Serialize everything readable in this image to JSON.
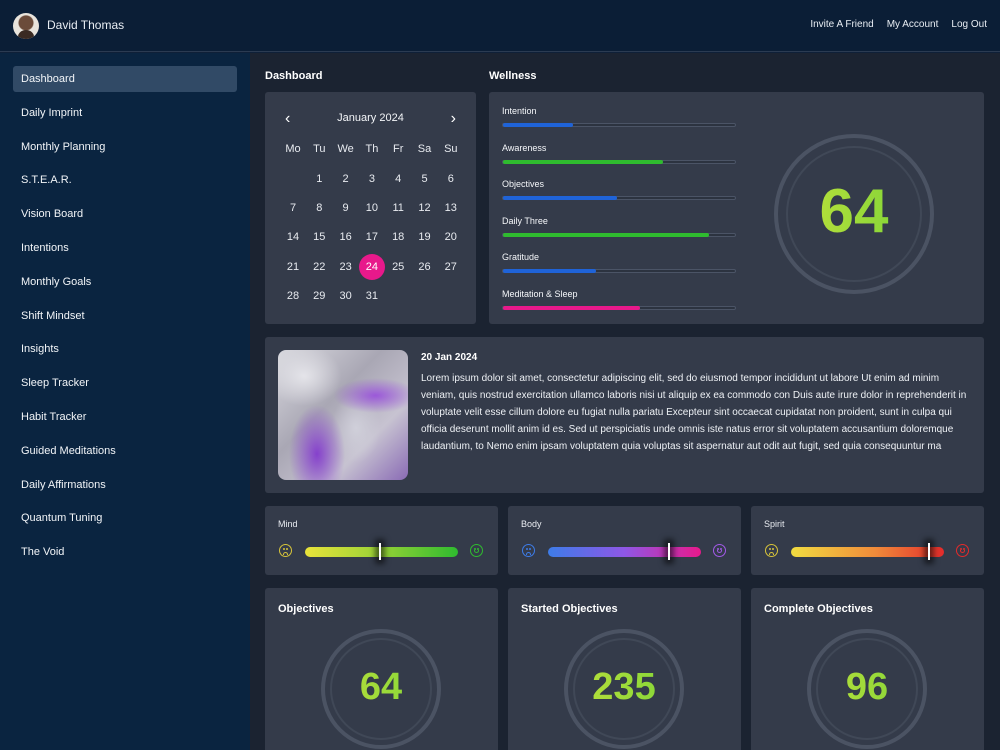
{
  "user": {
    "name": "David Thomas"
  },
  "topnav": [
    "Invite A Friend",
    "My Account",
    "Log Out"
  ],
  "sidebar": {
    "items": [
      {
        "label": "Dashboard",
        "active": true
      },
      {
        "label": "Daily Imprint"
      },
      {
        "label": "Monthly Planning"
      },
      {
        "label": "S.T.E.A.R."
      },
      {
        "label": "Vision Board"
      },
      {
        "label": "Intentions"
      },
      {
        "label": "Monthly Goals"
      },
      {
        "label": "Shift Mindset"
      },
      {
        "label": "Insights"
      },
      {
        "label": "Sleep Tracker"
      },
      {
        "label": "Habit Tracker"
      },
      {
        "label": "Guided Meditations"
      },
      {
        "label": "Daily Affirmations"
      },
      {
        "label": "Quantum Tuning"
      },
      {
        "label": "The Void"
      }
    ]
  },
  "dashboard": {
    "title": "Dashboard",
    "calendar": {
      "month_label": "January 2024",
      "prev_icon": "chevron-left-icon",
      "next_icon": "chevron-right-icon",
      "weekdays": [
        "Mo",
        "Tu",
        "We",
        "Th",
        "Fr",
        "Sa",
        "Su"
      ],
      "first_day_offset": 1,
      "days_in_month": 31,
      "selected_day": 24
    }
  },
  "wellness": {
    "title": "Wellness",
    "score": "64",
    "metrics": [
      {
        "label": "Intention",
        "percent": 30,
        "color": "#1f63d8"
      },
      {
        "label": "Awareness",
        "percent": 69,
        "color": "#2fbb2f"
      },
      {
        "label": "Objectives",
        "percent": 49,
        "color": "#1f63d8"
      },
      {
        "label": "Daily Three",
        "percent": 89,
        "color": "#2fbb2f"
      },
      {
        "label": "Gratitude",
        "percent": 40,
        "color": "#1f63d8"
      },
      {
        "label": "Meditation & Sleep",
        "percent": 59,
        "color": "#e8198b"
      }
    ]
  },
  "journal": {
    "date": "20 Jan 2024",
    "text": "Lorem ipsum dolor sit amet, consectetur adipiscing elit, sed do eiusmod tempor incididunt ut labore Ut enim ad minim veniam, quis nostrud exercitation ullamco laboris nisi ut aliquip ex ea commodo con Duis aute irure dolor in reprehenderit in voluptate velit esse cillum dolore eu fugiat nulla pariatu Excepteur sint occaecat cupidatat non proident, sunt in culpa qui officia deserunt mollit anim id es. Sed ut perspiciatis unde omnis iste natus error sit voluptatem accusantium doloremque laudantium, to Nemo enim ipsam voluptatem quia voluptas sit aspernatur aut odit aut fugit, sed quia consequuntur ma"
  },
  "moods": [
    {
      "label": "Mind",
      "value": 0.49,
      "gradient": "linear-gradient(90deg,#e9e33a,#9fd337 45%,#2fbb2f)",
      "sad_color": "#d7c43a",
      "happy_color": "#2fbb2f"
    },
    {
      "label": "Body",
      "value": 0.79,
      "gradient": "linear-gradient(90deg,#3d7ce8,#8e57e6 50%,#e8198b)",
      "sad_color": "#3d7ce8",
      "happy_color": "#a35ae8"
    },
    {
      "label": "Spirit",
      "value": 0.9,
      "gradient": "linear-gradient(90deg,#f1dc41,#f08b3a 55%,#e32b2b)",
      "sad_color": "#d7c43a",
      "happy_color": "#e32b2b"
    }
  ],
  "stats": [
    {
      "title": "Objectives",
      "value": "64"
    },
    {
      "title": "Started Objectives",
      "value": "235"
    },
    {
      "title": "Complete Objectives",
      "value": "96"
    }
  ]
}
